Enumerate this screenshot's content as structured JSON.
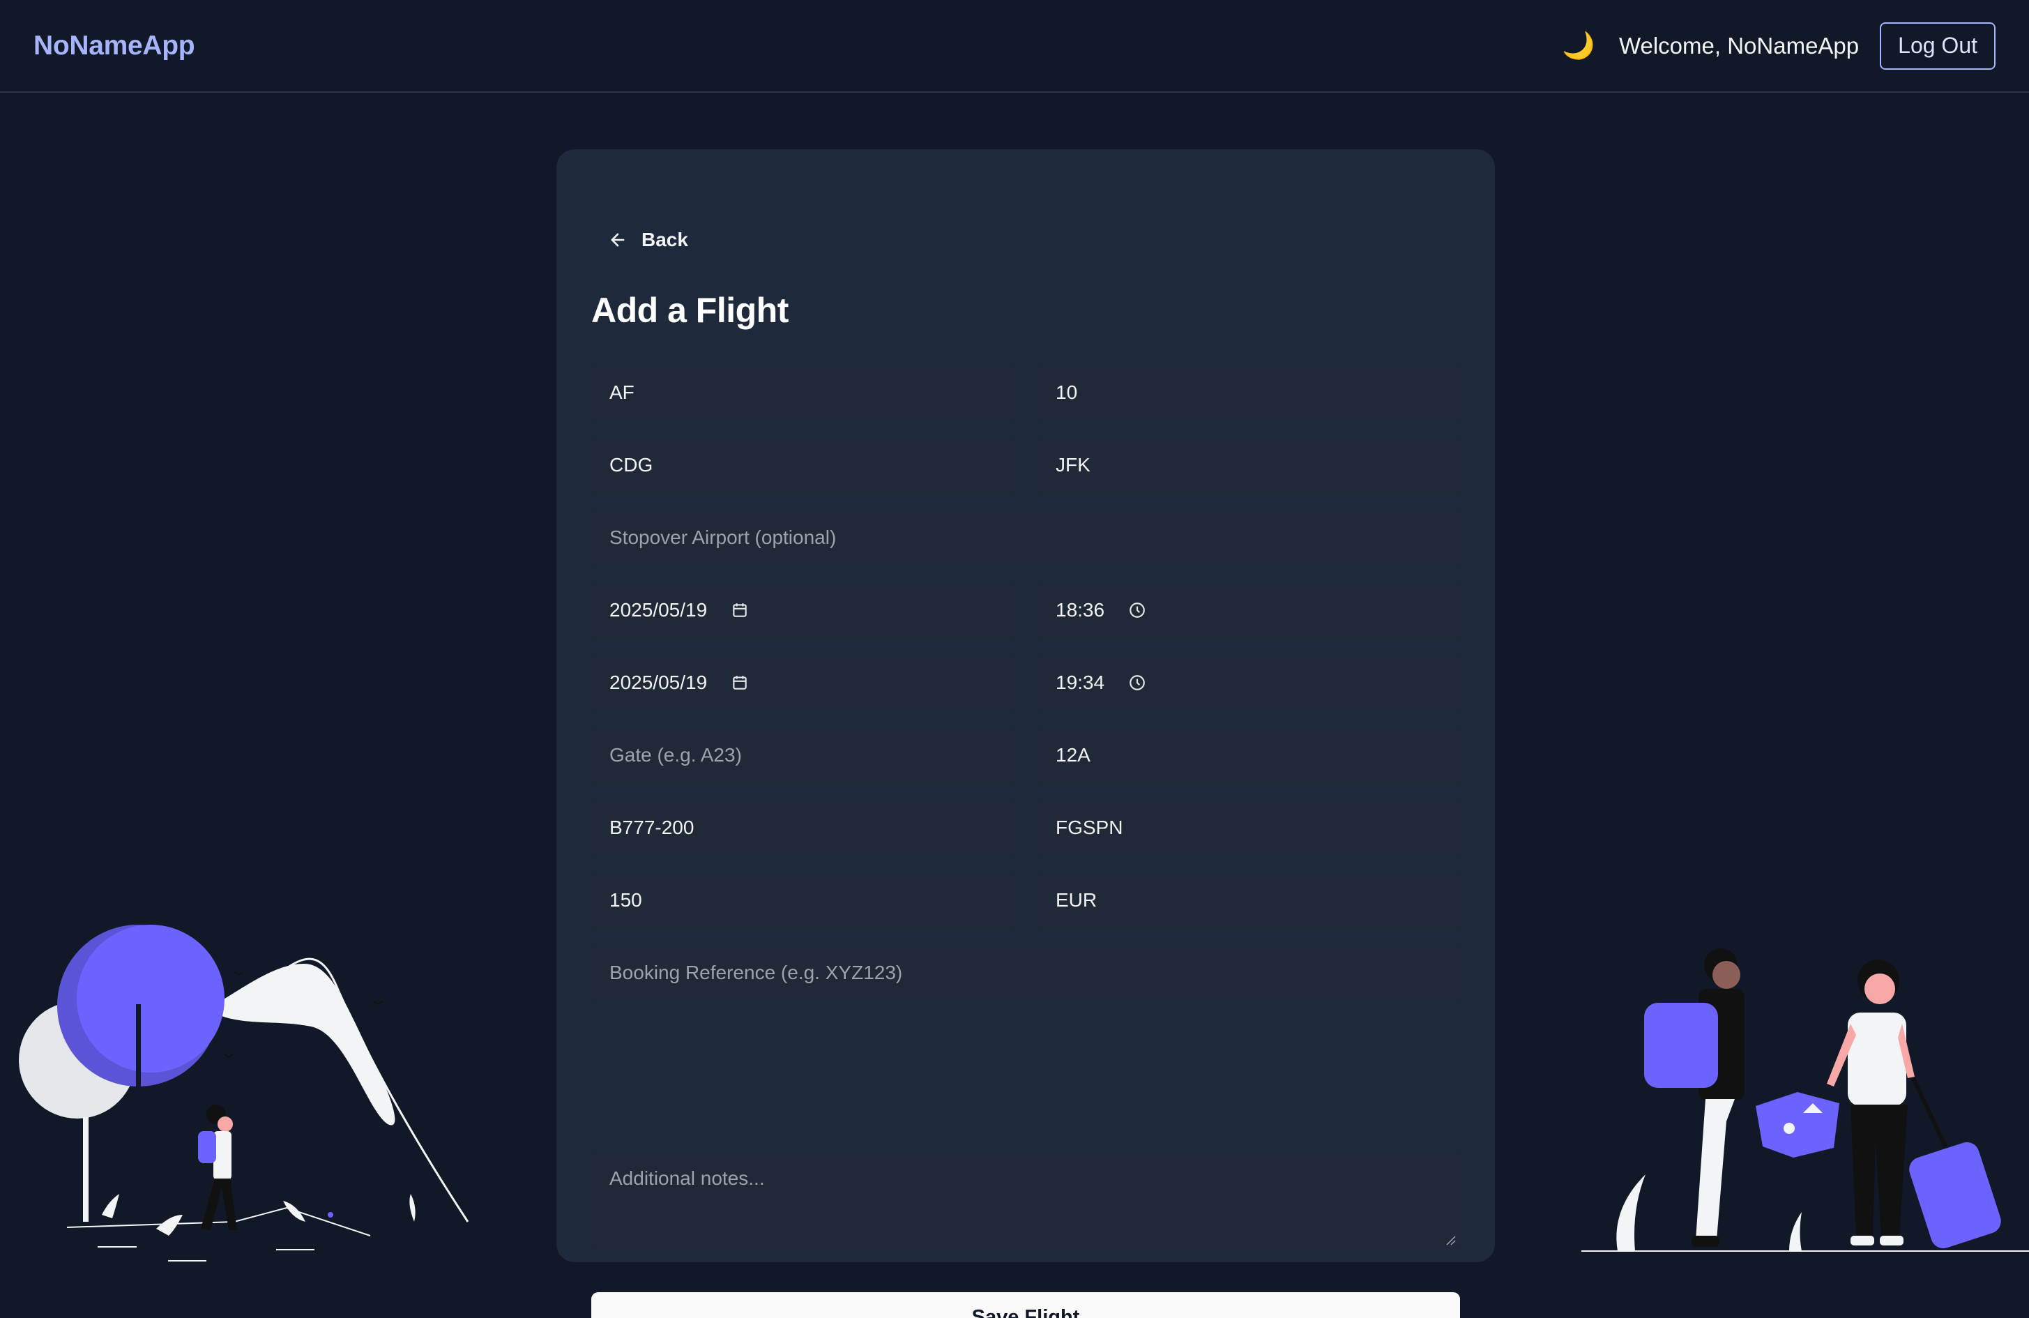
{
  "header": {
    "brand": "NoNameApp",
    "theme_icon": "🌙",
    "welcome": "Welcome, NoNameApp",
    "logout_label": "Log Out"
  },
  "form": {
    "back_label": "Back",
    "title": "Add a Flight",
    "airline": "AF",
    "flight_number": "10",
    "departure_airport": "CDG",
    "arrival_airport": "JFK",
    "stopover_placeholder": "Stopover Airport (optional)",
    "departure_date": "2025/05/19",
    "departure_time": "18:36",
    "arrival_date": "2025/05/19",
    "arrival_time": "19:34",
    "gate_placeholder": "Gate (e.g. A23)",
    "seat": "12A",
    "aircraft_type": "B777-200",
    "registration": "FGSPN",
    "price": "150",
    "currency": "EUR",
    "booking_placeholder": "Booking Reference (e.g. XYZ123)",
    "notes_placeholder": "Additional notes...",
    "save_label": "Save Flight"
  },
  "icons": {
    "back": "arrow-left-icon",
    "date": "calendar-icon",
    "time": "clock-icon",
    "theme": "moon-icon"
  },
  "colors": {
    "background": "#111827",
    "card": "#1e293b",
    "field": "#1f2937",
    "brand": "#a5b4fc",
    "accent": "#6c63ff"
  }
}
